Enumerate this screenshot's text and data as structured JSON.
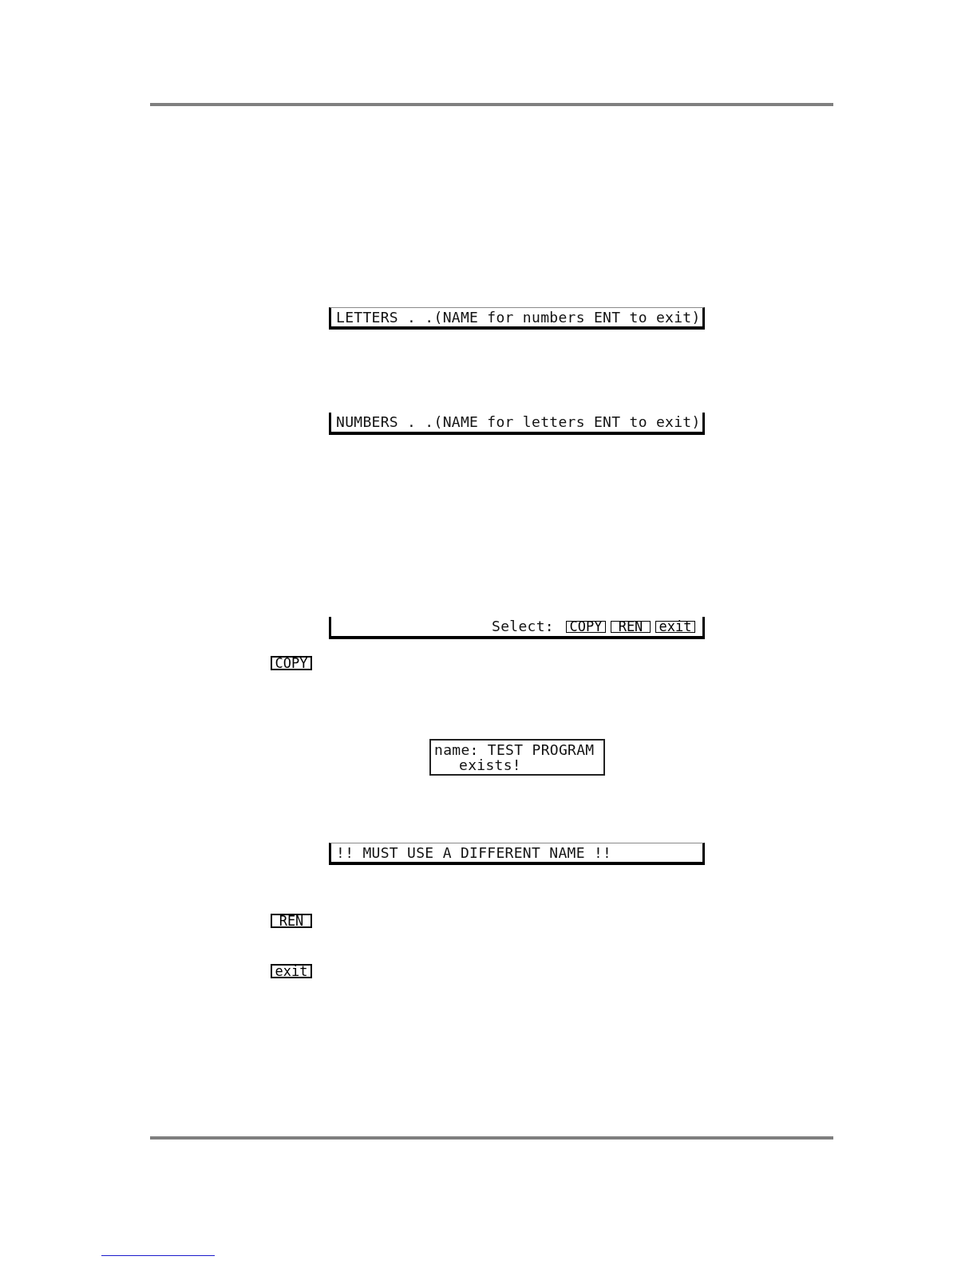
{
  "blocks": [
    {
      "kind": "lcd_strip",
      "top_edge": true,
      "text": "LETTERS . .(NAME for numbers ENT to exit)"
    },
    {
      "kind": "lcd_strip",
      "top_edge": false,
      "text": "NUMBERS . .(NAME for letters ENT to exit)"
    },
    {
      "kind": "lcd_menu",
      "top_edge": false,
      "prompt": "Select:",
      "softkeys": [
        "COPY",
        "REN",
        "exit"
      ]
    },
    {
      "kind": "softkey",
      "label": "COPY"
    },
    {
      "kind": "lcd_box",
      "lines": [
        "name: TEST PROGRAM",
        "exists!"
      ]
    },
    {
      "kind": "lcd_strip",
      "top_edge": true,
      "text": "!! MUST USE A DIFFERENT NAME !!"
    },
    {
      "kind": "softkey",
      "label": "REN"
    },
    {
      "kind": "softkey",
      "label": "exit"
    }
  ]
}
